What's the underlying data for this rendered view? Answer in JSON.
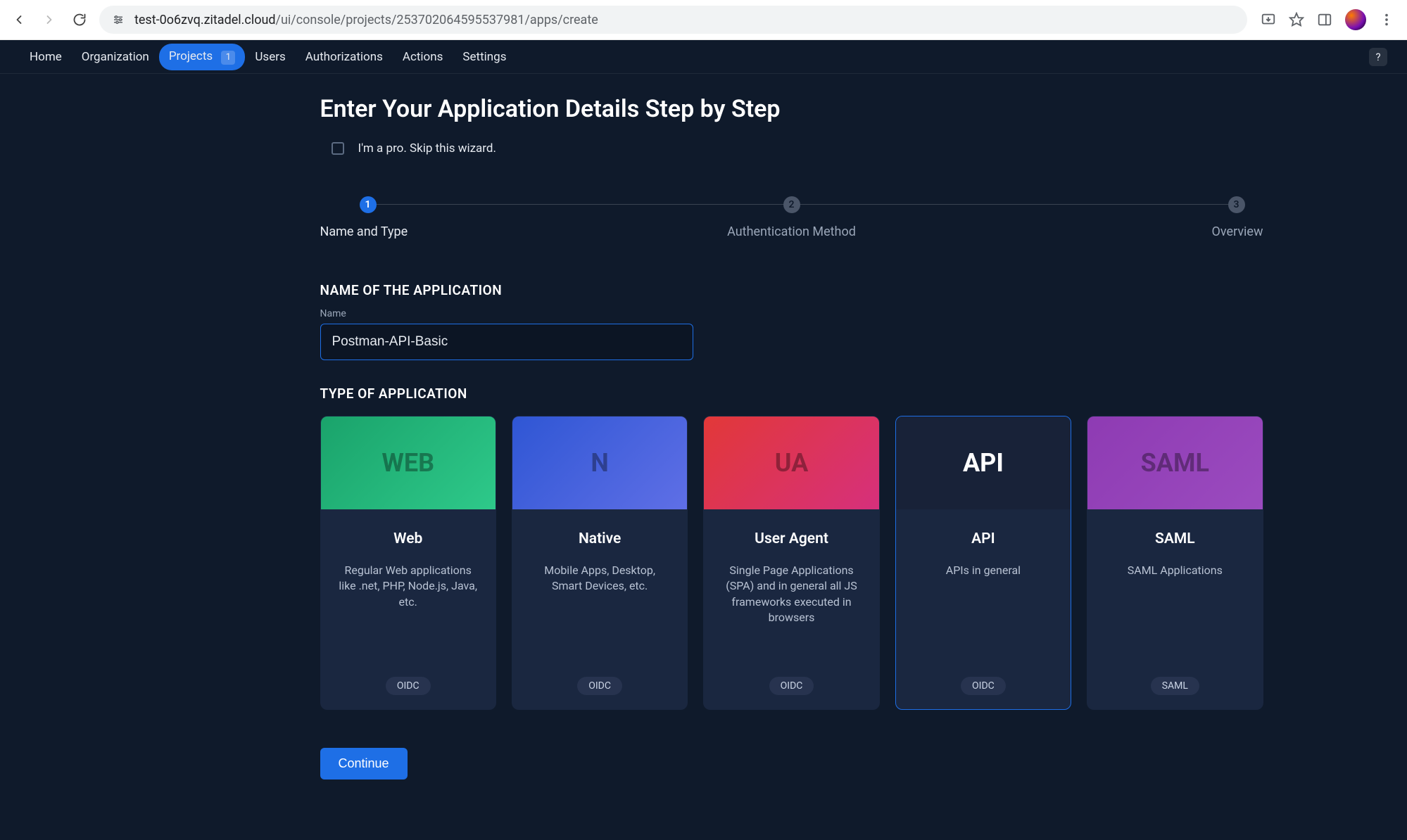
{
  "browser": {
    "url_host": "test-0o6zvq.zitadel.cloud",
    "url_path": "/ui/console/projects/253702064595537981/apps/create"
  },
  "nav": {
    "items": [
      "Home",
      "Organization",
      "Projects",
      "Users",
      "Authorizations",
      "Actions",
      "Settings"
    ],
    "projects_badge": "1",
    "help": "?"
  },
  "page": {
    "title": "Enter Your Application Details Step by Step",
    "skip_label": "I'm a pro. Skip this wizard."
  },
  "stepper": {
    "step1": {
      "num": "1",
      "label": "Name and Type"
    },
    "step2": {
      "num": "2",
      "label": "Authentication Method"
    },
    "step3": {
      "num": "3",
      "label": "Overview"
    }
  },
  "form": {
    "section_name": "NAME OF THE APPLICATION",
    "name_field_label": "Name",
    "name_value": "Postman-API-Basic",
    "section_type": "TYPE OF APPLICATION"
  },
  "cards": [
    {
      "head": "WEB",
      "title": "Web",
      "desc": "Regular Web applications like .net, PHP, Node.js, Java, etc.",
      "tag": "OIDC"
    },
    {
      "head": "N",
      "title": "Native",
      "desc": "Mobile Apps, Desktop, Smart Devices, etc.",
      "tag": "OIDC"
    },
    {
      "head": "UA",
      "title": "User Agent",
      "desc": "Single Page Applications (SPA) and in general all JS frameworks executed in browsers",
      "tag": "OIDC"
    },
    {
      "head": "API",
      "title": "API",
      "desc": "APIs in general",
      "tag": "OIDC"
    },
    {
      "head": "SAML",
      "title": "SAML",
      "desc": "SAML Applications",
      "tag": "SAML"
    }
  ],
  "buttons": {
    "continue": "Continue"
  }
}
